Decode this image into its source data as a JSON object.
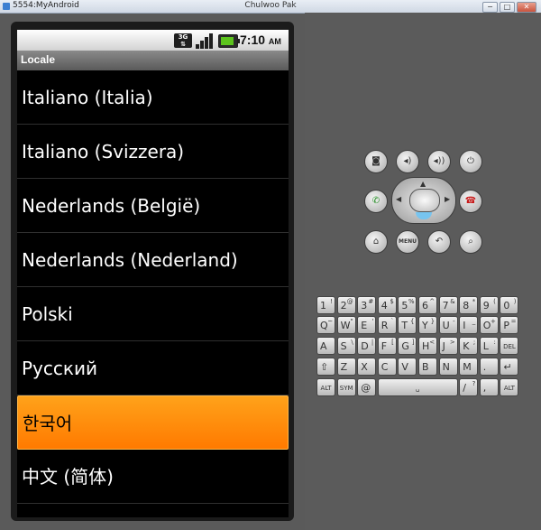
{
  "window": {
    "title": "5554:MyAndroid",
    "user": "Chulwoo Pak",
    "min": "−",
    "max": "□",
    "close": "✕"
  },
  "statusbar": {
    "network": "3G",
    "time": "7:10",
    "ampm": "AM"
  },
  "app": {
    "title": "Locale"
  },
  "locales": [
    {
      "label": "Italiano (Italia)",
      "selected": false
    },
    {
      "label": "Italiano (Svizzera)",
      "selected": false
    },
    {
      "label": "Nederlands (België)",
      "selected": false
    },
    {
      "label": "Nederlands (Nederland)",
      "selected": false
    },
    {
      "label": "Polski",
      "selected": false
    },
    {
      "label": "Русский",
      "selected": false
    },
    {
      "label": "한국어",
      "selected": true
    },
    {
      "label": "中文 (简体)",
      "selected": false
    }
  ],
  "controls": {
    "menu": "MENU"
  },
  "keyboard": {
    "row1": [
      {
        "k": "1",
        "s": "!"
      },
      {
        "k": "2",
        "s": "@"
      },
      {
        "k": "3",
        "s": "#"
      },
      {
        "k": "4",
        "s": "$"
      },
      {
        "k": "5",
        "s": "%"
      },
      {
        "k": "6",
        "s": "^"
      },
      {
        "k": "7",
        "s": "&"
      },
      {
        "k": "8",
        "s": "*"
      },
      {
        "k": "9",
        "s": "("
      },
      {
        "k": "0",
        "s": ")"
      }
    ],
    "row2": [
      {
        "k": "Q",
        "s": "~"
      },
      {
        "k": "W",
        "s": "\""
      },
      {
        "k": "E",
        "s": "'"
      },
      {
        "k": "R",
        "s": "`"
      },
      {
        "k": "T",
        "s": "{"
      },
      {
        "k": "Y",
        "s": "}"
      },
      {
        "k": "U",
        "s": "-"
      },
      {
        "k": "I",
        "s": "_"
      },
      {
        "k": "O",
        "s": "+"
      },
      {
        "k": "P",
        "s": "="
      }
    ],
    "row3": [
      {
        "k": "A",
        "s": ""
      },
      {
        "k": "S",
        "s": "\\"
      },
      {
        "k": "D",
        "s": "|"
      },
      {
        "k": "F",
        "s": "["
      },
      {
        "k": "G",
        "s": "]"
      },
      {
        "k": "H",
        "s": "<"
      },
      {
        "k": "J",
        "s": ">"
      },
      {
        "k": "K",
        "s": ";"
      },
      {
        "k": "L",
        "s": ":"
      }
    ],
    "del": "DEL",
    "row4": [
      {
        "k": "Z",
        "s": ""
      },
      {
        "k": "X",
        "s": ""
      },
      {
        "k": "C",
        "s": ""
      },
      {
        "k": "V",
        "s": ""
      },
      {
        "k": "B",
        "s": ""
      },
      {
        "k": "N",
        "s": ""
      },
      {
        "k": "M",
        "s": ""
      },
      {
        "k": ".",
        "s": ""
      }
    ],
    "alt": "ALT",
    "sym": "SYM",
    "at": "@",
    "slash": "/",
    "comma": ",",
    "question": "?"
  }
}
